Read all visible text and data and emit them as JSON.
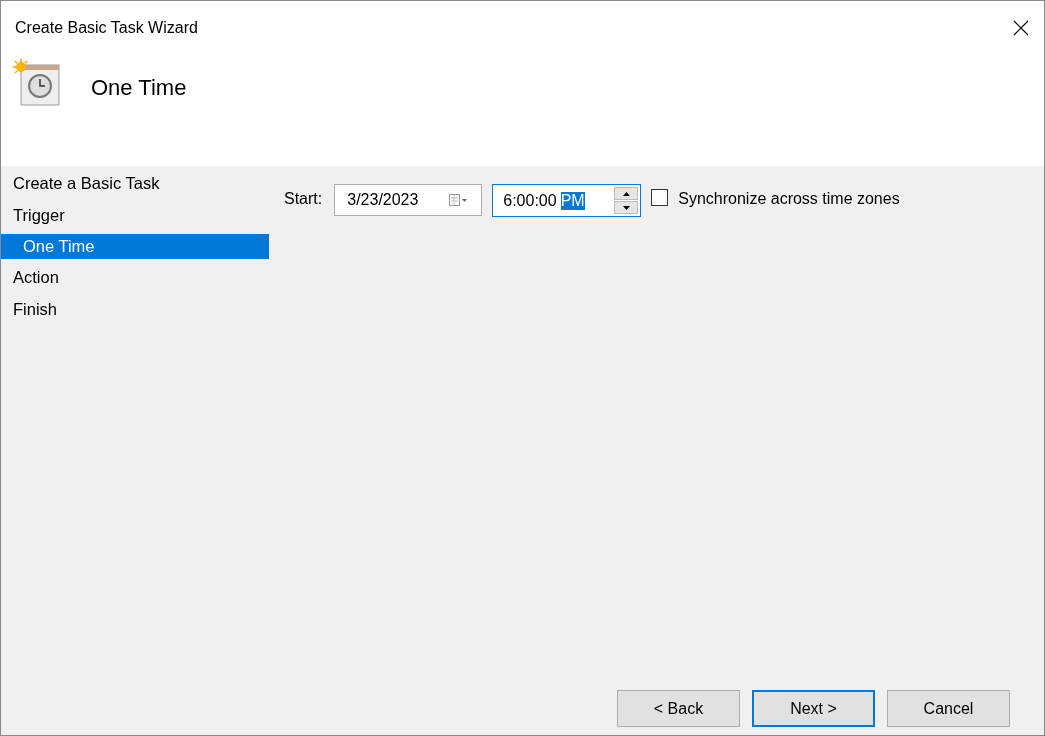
{
  "window": {
    "title": "Create Basic Task Wizard"
  },
  "header": {
    "title": "One Time"
  },
  "steps": [
    {
      "label": "Create a Basic Task",
      "selected": false
    },
    {
      "label": "Trigger",
      "selected": false,
      "children": [
        {
          "label": "One Time",
          "selected": true
        }
      ]
    },
    {
      "label": "Action",
      "selected": false
    },
    {
      "label": "Finish",
      "selected": false
    }
  ],
  "start": {
    "label": "Start:",
    "date": "3/23/2023",
    "time": "6:00:00",
    "period": "PM",
    "period_selected": true
  },
  "sync": {
    "label": "Synchronize across time zones",
    "checked": false
  },
  "buttons": [
    {
      "label": "< Back",
      "default": false
    },
    {
      "label": "Next >",
      "default": true
    },
    {
      "label": "Cancel",
      "default": false
    }
  ]
}
